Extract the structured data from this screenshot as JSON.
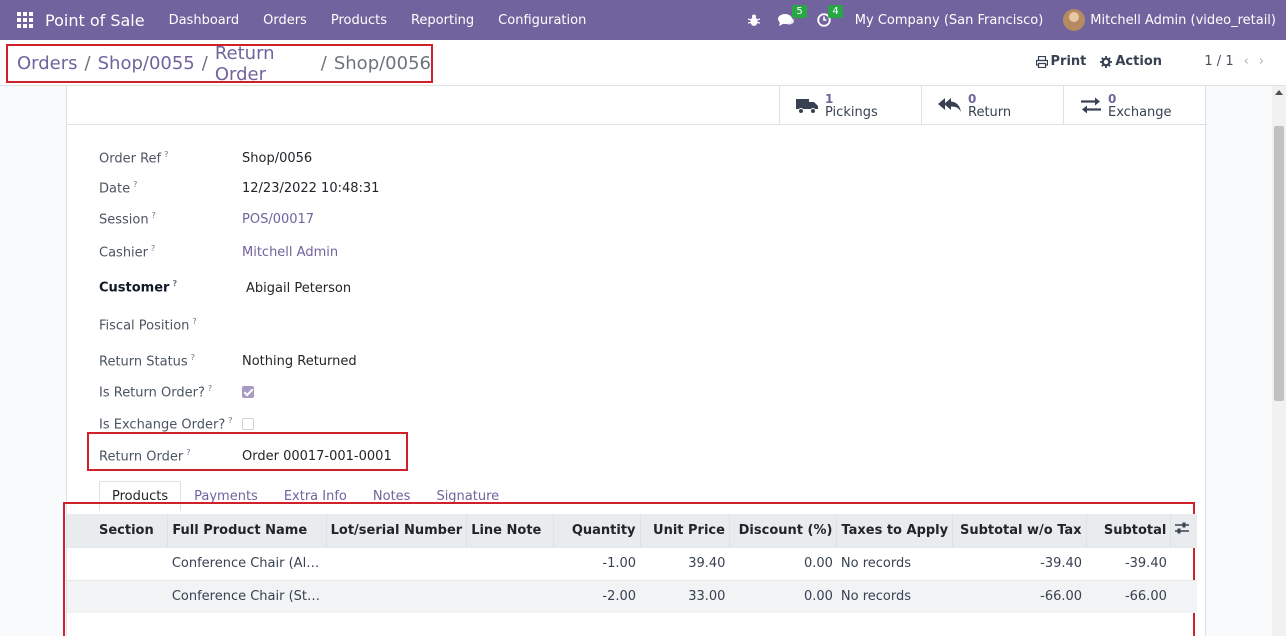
{
  "navbar": {
    "app_title": "Point of Sale",
    "menu": [
      "Dashboard",
      "Orders",
      "Products",
      "Reporting",
      "Configuration"
    ],
    "messages_badge": "5",
    "activities_badge": "4",
    "company": "My Company (San Francisco)",
    "user": "Mitchell Admin (video_retail)"
  },
  "breadcrumb": {
    "items": [
      "Orders",
      "Shop/0055",
      "Return Order"
    ],
    "current": "Shop/0056",
    "sep": "/"
  },
  "control": {
    "print_label": "Print",
    "action_label": "Action",
    "pager": "1 / 1"
  },
  "smart_buttons": [
    {
      "value": "1",
      "label": "Pickings"
    },
    {
      "value": "0",
      "label": "Return"
    },
    {
      "value": "0",
      "label": "Exchange"
    }
  ],
  "fields": {
    "order_ref": {
      "label": "Order Ref",
      "value": "Shop/0056"
    },
    "date": {
      "label": "Date",
      "value": "12/23/2022 10:48:31"
    },
    "session": {
      "label": "Session",
      "value": "POS/00017"
    },
    "cashier": {
      "label": "Cashier",
      "value": "Mitchell Admin"
    },
    "customer": {
      "label": "Customer",
      "value": "Abigail Peterson"
    },
    "fiscal_position": {
      "label": "Fiscal Position",
      "value": ""
    },
    "return_status": {
      "label": "Return Status",
      "value": "Nothing Returned"
    },
    "is_return": {
      "label": "Is Return Order?",
      "checked": true
    },
    "is_exchange": {
      "label": "Is Exchange Order?",
      "checked": false
    },
    "return_order": {
      "label": "Return Order",
      "value": "Order 00017-001-0001"
    },
    "help_mark": "?"
  },
  "tabs": [
    "Products",
    "Payments",
    "Extra Info",
    "Notes",
    "Signature"
  ],
  "table": {
    "headers": [
      "Section",
      "Full Product Name",
      "Lot/serial Number",
      "Line Note",
      "Quantity",
      "Unit Price",
      "Discount (%)",
      "Taxes to Apply",
      "Subtotal w/o Tax",
      "Subtotal"
    ],
    "rows": [
      [
        "",
        "Conference Chair (Alu…",
        "",
        "",
        "-1.00",
        "39.40",
        "0.00",
        "No records",
        "-39.40",
        "-39.40"
      ],
      [
        "",
        "Conference Chair (Steel)",
        "",
        "",
        "-2.00",
        "33.00",
        "0.00",
        "No records",
        "-66.00",
        "-66.00"
      ]
    ]
  }
}
